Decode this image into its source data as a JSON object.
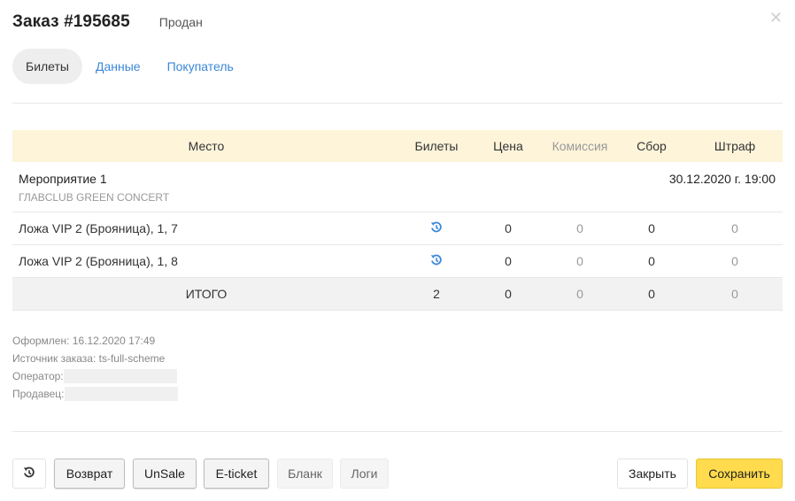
{
  "header": {
    "title": "Заказ #195685",
    "status": "Продан"
  },
  "tabs": [
    {
      "label": "Билеты",
      "active": true
    },
    {
      "label": "Данные",
      "active": false
    },
    {
      "label": "Покупатель",
      "active": false
    }
  ],
  "table": {
    "columns": [
      "Место",
      "Билеты",
      "Цена",
      "Комиссия",
      "Сбор",
      "Штраф"
    ],
    "event": {
      "name": "Мероприятие 1",
      "venue": "ГЛАВCLUB GREEN CONCERT",
      "datetime": "30.12.2020 г. 19:00"
    },
    "rows": [
      {
        "place": "Ложа VIP 2 (Брояница), 1, 7",
        "tickets_icon": "refund-icon",
        "price": "0",
        "commission": "0",
        "fee": "0",
        "fine": "0"
      },
      {
        "place": "Ложа VIP 2 (Брояница), 1, 8",
        "tickets_icon": "refund-icon",
        "price": "0",
        "commission": "0",
        "fee": "0",
        "fine": "0"
      }
    ],
    "total": {
      "label": "ИТОГО",
      "tickets": "2",
      "price": "0",
      "commission": "0",
      "fee": "0",
      "fine": "0"
    }
  },
  "info": {
    "created": "Оформлен: 16.12.2020 17:49",
    "source": "Источник заказа: ts-full-scheme",
    "operator_label": "Оператор:",
    "seller_label": "Продавец:"
  },
  "footer": {
    "buttons": {
      "refund_icon": "refund-icon",
      "return": "Возврат",
      "unsale": "UnSale",
      "eticket": "E-ticket",
      "blank": "Бланк",
      "logs": "Логи",
      "close": "Закрыть",
      "save": "Сохранить"
    }
  },
  "colors": {
    "accent_blue": "#3b88d8",
    "header_row": "#fdf4da",
    "save_button": "#ffdb4d",
    "muted_text": "#999999"
  },
  "icons": {
    "close": "close-icon",
    "refund": "refund-icon"
  }
}
